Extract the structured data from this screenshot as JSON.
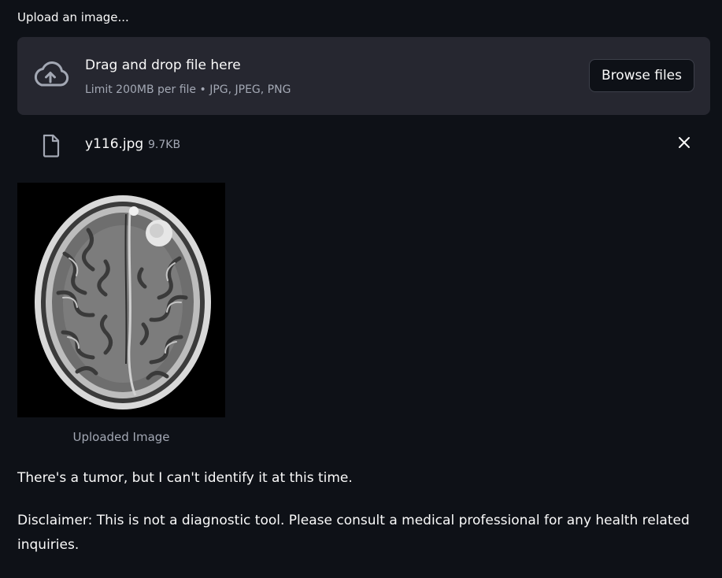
{
  "uploader": {
    "label": "Upload an image...",
    "drop_title": "Drag and drop file here",
    "drop_subtitle": "Limit 200MB per file • JPG, JPEG, PNG",
    "browse_label": "Browse files"
  },
  "file": {
    "name": "y116.jpg",
    "size": "9.7KB"
  },
  "image": {
    "caption": "Uploaded Image"
  },
  "result": {
    "text": "There's a tumor, but I can't identify it at this time."
  },
  "disclaimer": {
    "text": "Disclaimer: This is not a diagnostic tool. Please consult a medical professional for any health related inquiries."
  },
  "icons": {
    "upload": "cloud-upload-icon",
    "file": "file-icon",
    "close": "close-icon"
  },
  "colors": {
    "background": "#0e1117",
    "panel": "#262730",
    "text": "#fafafa",
    "muted": "#a3a8b4"
  }
}
